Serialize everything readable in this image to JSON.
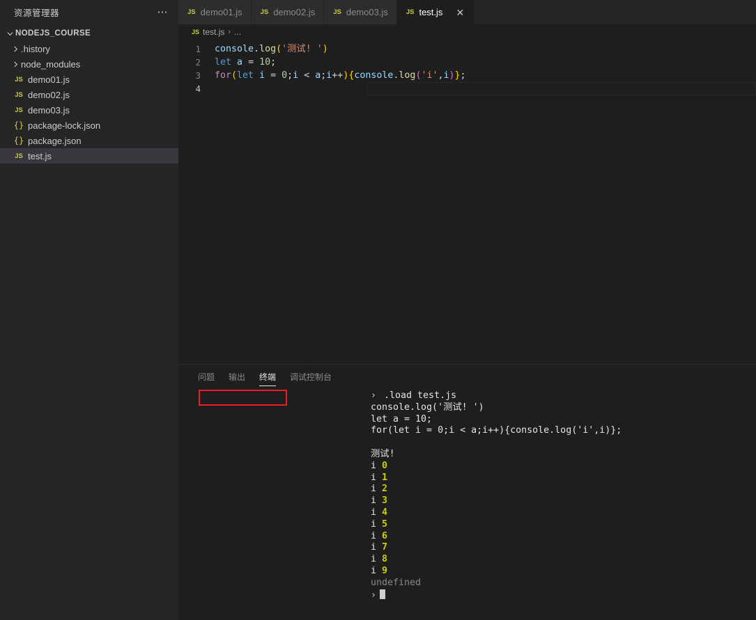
{
  "sidebar": {
    "header_title": "资源管理器",
    "more_icon": "ellipsis-icon",
    "root": {
      "label": "NODEJS_COURSE",
      "chevron": "chevron-down-icon"
    },
    "items": [
      {
        "label": ".history",
        "kind": "folder",
        "icon": "chevron-right-icon",
        "selected": false
      },
      {
        "label": "node_modules",
        "kind": "folder",
        "icon": "chevron-right-icon",
        "selected": false
      },
      {
        "label": "demo01.js",
        "kind": "js",
        "icon": "js-file-icon",
        "selected": false
      },
      {
        "label": "demo02.js",
        "kind": "js",
        "icon": "js-file-icon",
        "selected": false
      },
      {
        "label": "demo03.js",
        "kind": "js",
        "icon": "js-file-icon",
        "selected": false
      },
      {
        "label": "package-lock.json",
        "kind": "json",
        "icon": "json-file-icon",
        "selected": false
      },
      {
        "label": "package.json",
        "kind": "json",
        "icon": "json-file-icon",
        "selected": false
      },
      {
        "label": "test.js",
        "kind": "js",
        "icon": "js-file-icon",
        "selected": true
      }
    ]
  },
  "tabs": [
    {
      "label": "demo01.js",
      "icon": "js-file-icon",
      "active": false,
      "closable": false
    },
    {
      "label": "demo02.js",
      "icon": "js-file-icon",
      "active": false,
      "closable": false
    },
    {
      "label": "demo03.js",
      "icon": "js-file-icon",
      "active": false,
      "closable": false
    },
    {
      "label": "test.js",
      "icon": "js-file-icon",
      "active": true,
      "closable": true
    }
  ],
  "tab_close_glyph": "✕",
  "breadcrumb": {
    "icon": "js-file-icon",
    "file": "test.js",
    "separator": "›",
    "overflow": "..."
  },
  "editor": {
    "line_numbers": [
      "1",
      "2",
      "3",
      "4"
    ],
    "lines": [
      "console.log('测试! ')",
      "let a = 10;",
      "for(let i = 0;i < a;i++){console.log('i',i)};",
      ""
    ],
    "active_line": 4
  },
  "panel": {
    "tabs": [
      {
        "label": "问题",
        "active": false
      },
      {
        "label": "输出",
        "active": false
      },
      {
        "label": "终端",
        "active": true
      },
      {
        "label": "调试控制台",
        "active": false
      }
    ],
    "terminal": {
      "prompt": "›",
      "command": ".load test.js",
      "echo": [
        "console.log('测试! ')",
        "let a = 10;",
        "for(let i = 0;i < a;i++){console.log('i',i)};"
      ],
      "program_output_text": "测试!",
      "loop_label": "i",
      "loop_values": [
        "0",
        "1",
        "2",
        "3",
        "4",
        "5",
        "6",
        "7",
        "8",
        "9"
      ],
      "return_value": "undefined",
      "cursor": "block-cursor"
    }
  },
  "annotation": {
    "shape": "red-rectangle",
    "color": "#ee1c25",
    "target": ".load test.js"
  }
}
